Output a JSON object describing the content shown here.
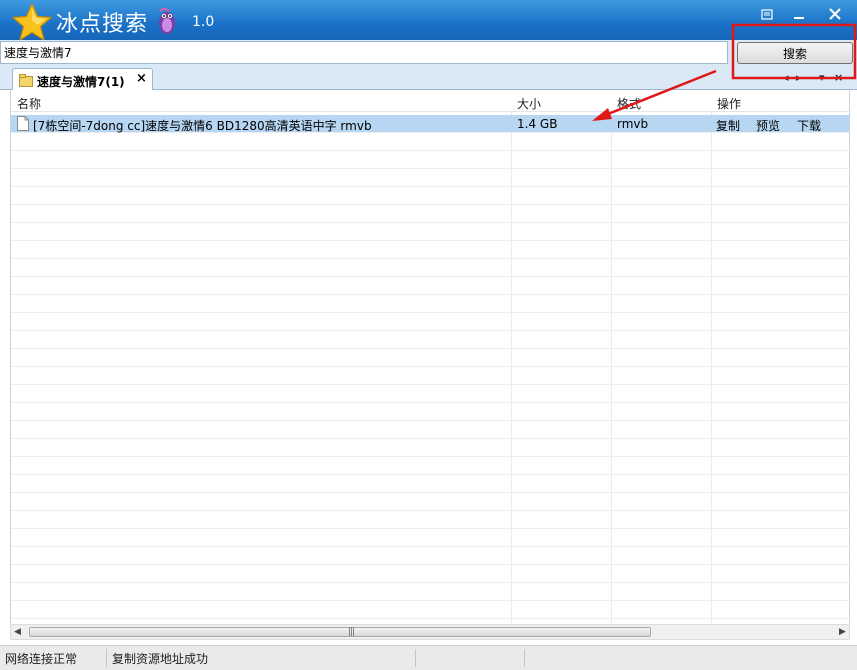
{
  "window": {
    "title": "冰点搜索",
    "version": "1.0",
    "controls": [
      "restore-icon",
      "minimize-icon",
      "close-icon"
    ]
  },
  "search": {
    "value": "速度与激情7",
    "button_label": "搜索"
  },
  "tabs": [
    {
      "label": "速度与激情7(1)",
      "close_label": "×"
    }
  ],
  "table": {
    "columns": [
      "名称",
      "大小",
      "格式",
      "操作"
    ],
    "rows": [
      {
        "name": "[7栋空间-7dong cc]速度与激情6 BD1280高清英语中字 rmvb",
        "size": "1.4 GB",
        "format": "rmvb",
        "actions": [
          "复制",
          "预览",
          "下载"
        ],
        "selected": true
      }
    ]
  },
  "statusbar": {
    "network": "网络连接正常",
    "message": "复制资源地址成功"
  },
  "colors": {
    "titlebar": "#1a72c8",
    "selected_row": "#b7d6f2",
    "annotation_red": "#e01818"
  }
}
